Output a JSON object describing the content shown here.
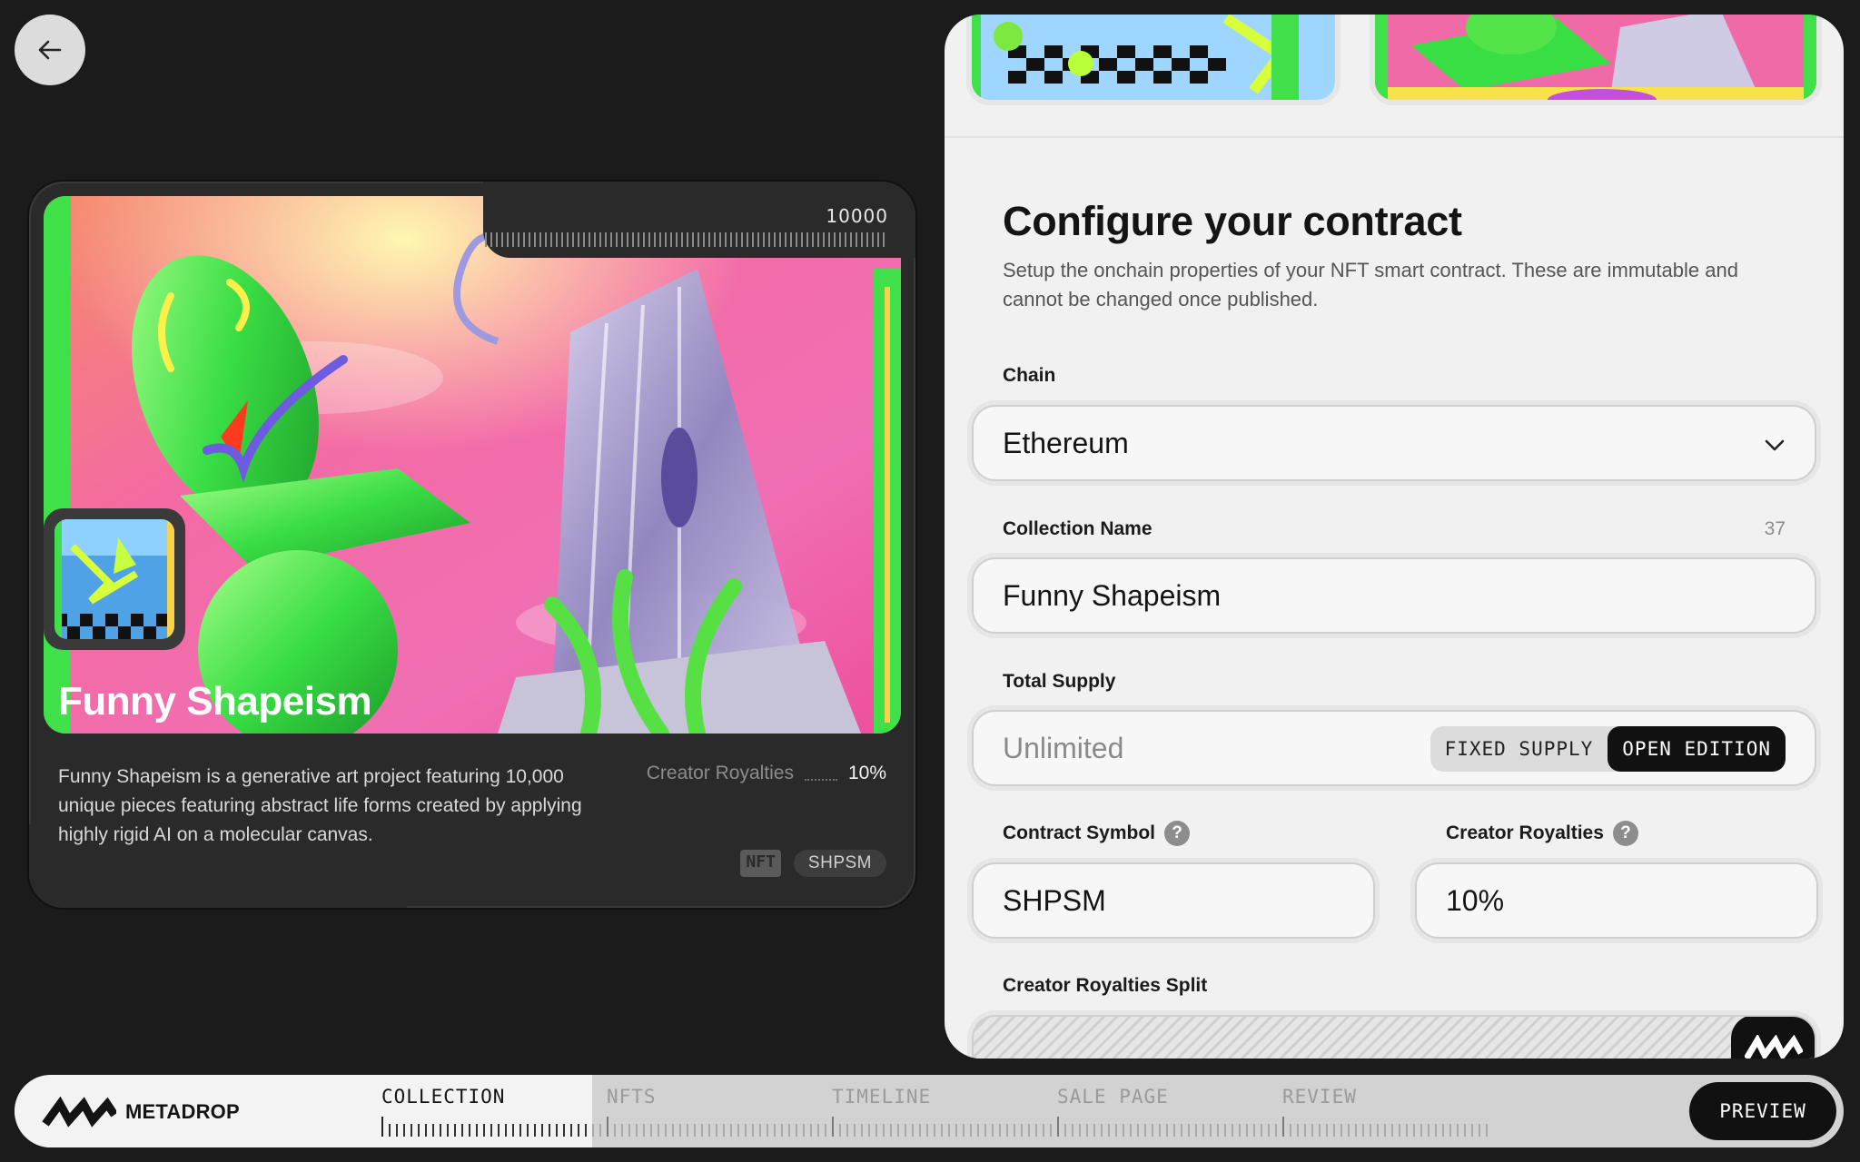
{
  "card": {
    "supply_number": "10000",
    "title": "Funny Shapeism",
    "description": "Funny Shapeism is a generative art project featuring 10,000 unique pieces featuring abstract life forms created by applying highly rigid AI on a molecular canvas.",
    "royalty_label": "Creator Royalties",
    "royalty_value": "10%",
    "tag_nft": "NFT",
    "tag_symbol": "SHPSM"
  },
  "panel": {
    "heading": "Configure your contract",
    "subheading": "Setup the onchain properties of your NFT smart contract. These are immutable and cannot be changed once published.",
    "chain": {
      "label": "Chain",
      "value": "Ethereum"
    },
    "collection_name": {
      "label": "Collection Name",
      "value": "Funny Shapeism",
      "char_count": "37"
    },
    "total_supply": {
      "label": "Total Supply",
      "placeholder": "Unlimited",
      "options": [
        "FIXED SUPPLY",
        "OPEN EDITION"
      ],
      "selected": "OPEN EDITION"
    },
    "contract_symbol": {
      "label": "Contract Symbol",
      "value": "SHPSM",
      "help": "?"
    },
    "creator_royalties": {
      "label": "Creator Royalties",
      "value": "10%",
      "help": "?"
    },
    "royalties_split": {
      "label": "Creator Royalties Split"
    }
  },
  "nav": {
    "brand": "METADROP",
    "steps": [
      "COLLECTION",
      "NFTS",
      "TIMELINE",
      "SALE PAGE",
      "REVIEW"
    ],
    "active_step": "COLLECTION",
    "preview_label": "PREVIEW"
  },
  "icons": {
    "back": "arrow-left-icon",
    "chevron": "chevron-down-icon",
    "logo": "metadrop-zigzag-icon"
  },
  "colors": {
    "background": "#1b1b1b",
    "panel": "#f1f1f1",
    "accent_dark": "#111111",
    "art_pink": "#f26aa8",
    "art_green": "#3fe04a"
  }
}
